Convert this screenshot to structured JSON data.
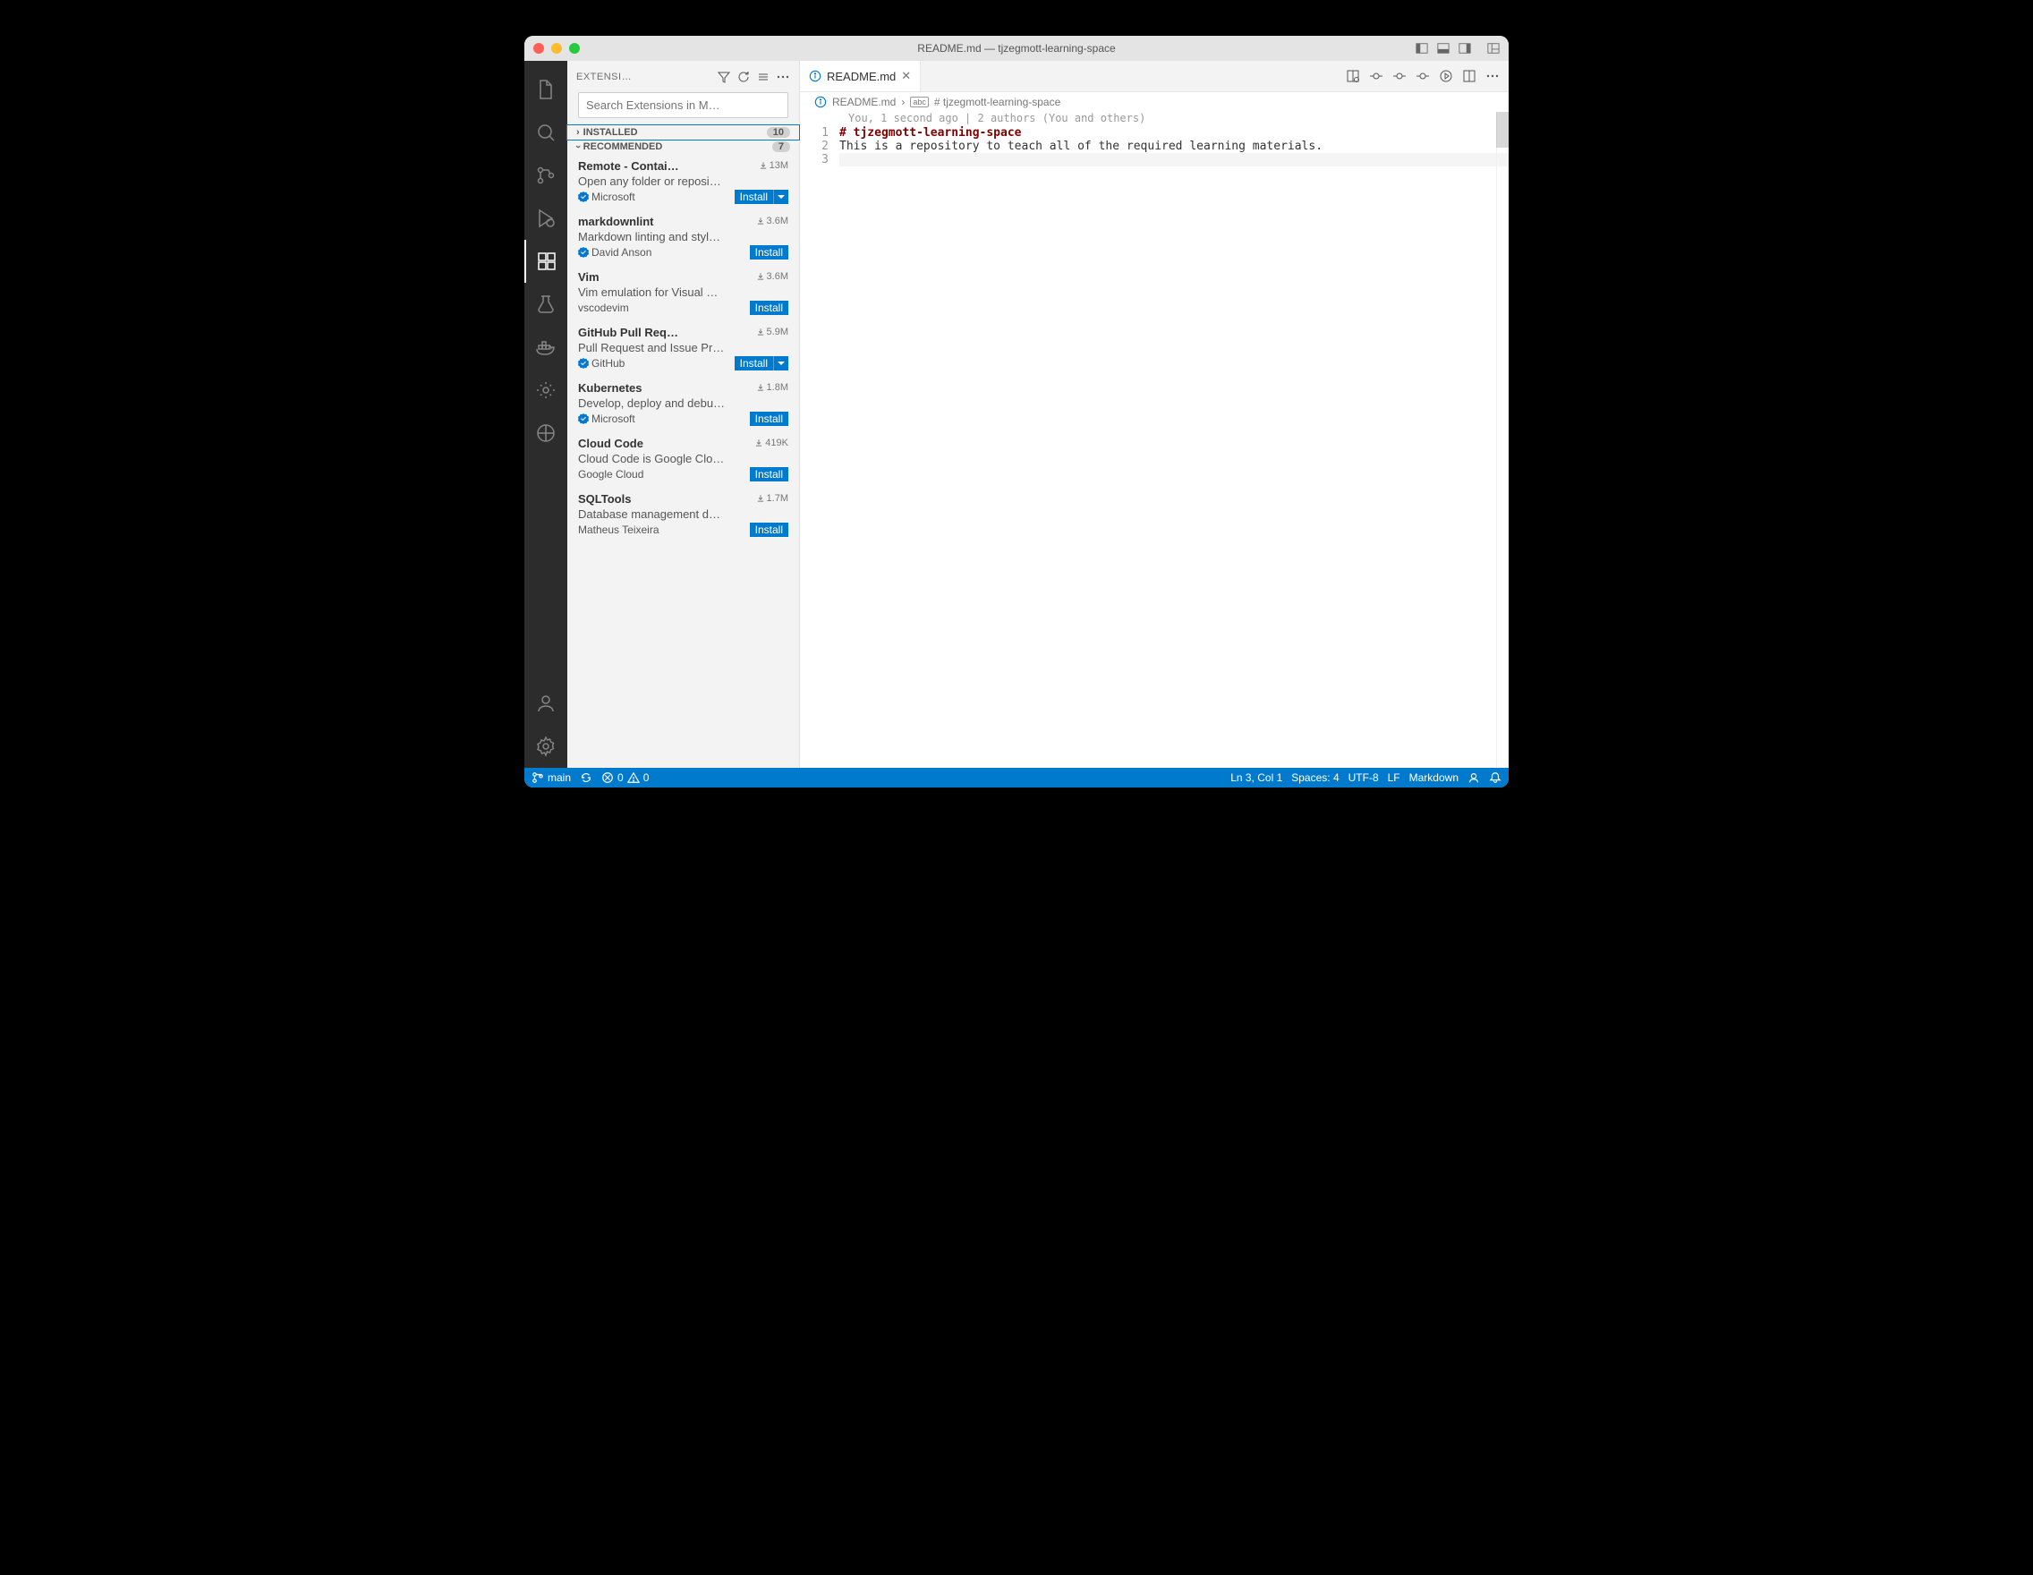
{
  "window": {
    "title": "README.md — tjzegmott-learning-space"
  },
  "sidebar": {
    "title": "EXTENSI…",
    "search_placeholder": "Search Extensions in M…",
    "sections": {
      "installed": {
        "label": "INSTALLED",
        "count": "10"
      },
      "recommended": {
        "label": "RECOMMENDED",
        "count": "7"
      }
    },
    "extensions": [
      {
        "name": "Remote - Contai…",
        "downloads": "13M",
        "desc": "Open any folder or reposi…",
        "publisher": "Microsoft",
        "verified": true,
        "split": true,
        "install": "Install"
      },
      {
        "name": "markdownlint",
        "downloads": "3.6M",
        "desc": "Markdown linting and styl…",
        "publisher": "David Anson",
        "verified": true,
        "split": false,
        "install": "Install"
      },
      {
        "name": "Vim",
        "downloads": "3.6M",
        "desc": "Vim emulation for Visual …",
        "publisher": "vscodevim",
        "verified": false,
        "split": false,
        "install": "Install"
      },
      {
        "name": "GitHub Pull Req…",
        "downloads": "5.9M",
        "desc": "Pull Request and Issue Pr…",
        "publisher": "GitHub",
        "verified": true,
        "split": true,
        "install": "Install"
      },
      {
        "name": "Kubernetes",
        "downloads": "1.8M",
        "desc": "Develop, deploy and debu…",
        "publisher": "Microsoft",
        "verified": true,
        "split": false,
        "install": "Install"
      },
      {
        "name": "Cloud Code",
        "downloads": "419K",
        "desc": "Cloud Code is Google Clo…",
        "publisher": "Google Cloud",
        "verified": false,
        "split": false,
        "install": "Install"
      },
      {
        "name": "SQLTools",
        "downloads": "1.7M",
        "desc": "Database management d…",
        "publisher": "Matheus Teixeira",
        "verified": false,
        "split": false,
        "install": "Install"
      }
    ]
  },
  "tab": {
    "name": "README.md"
  },
  "breadcrumb": {
    "file": "README.md",
    "symbol": "# tjzegmott-learning-space"
  },
  "blame": "You, 1 second ago | 2 authors (You and others)",
  "code": {
    "lines": [
      {
        "n": "1",
        "html": "# tjzegmott-learning-space",
        "cls": "h1"
      },
      {
        "n": "2",
        "html": "This is a repository to teach all of the required learning materials.",
        "cls": ""
      },
      {
        "n": "3",
        "html": "",
        "cls": "cursor"
      }
    ]
  },
  "status": {
    "branch": "main",
    "errors": "0",
    "warnings": "0",
    "pos": "Ln 3, Col 1",
    "spaces": "Spaces: 4",
    "encoding": "UTF-8",
    "eol": "LF",
    "lang": "Markdown"
  }
}
